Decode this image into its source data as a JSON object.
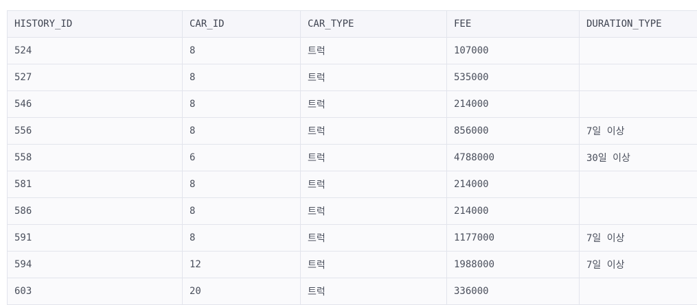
{
  "table": {
    "columns": [
      "HISTORY_ID",
      "CAR_ID",
      "CAR_TYPE",
      "FEE",
      "DURATION_TYPE"
    ],
    "rows": [
      [
        "524",
        "8",
        "트럭",
        "107000",
        ""
      ],
      [
        "527",
        "8",
        "트럭",
        "535000",
        ""
      ],
      [
        "546",
        "8",
        "트럭",
        "214000",
        ""
      ],
      [
        "556",
        "8",
        "트럭",
        "856000",
        "7일 이상"
      ],
      [
        "558",
        "6",
        "트럭",
        "4788000",
        "30일 이상"
      ],
      [
        "581",
        "8",
        "트럭",
        "214000",
        ""
      ],
      [
        "586",
        "8",
        "트럭",
        "214000",
        ""
      ],
      [
        "591",
        "8",
        "트럭",
        "1177000",
        "7일 이상"
      ],
      [
        "594",
        "12",
        "트럭",
        "1988000",
        "7일 이상"
      ],
      [
        "603",
        "20",
        "트럭",
        "336000",
        ""
      ]
    ]
  }
}
